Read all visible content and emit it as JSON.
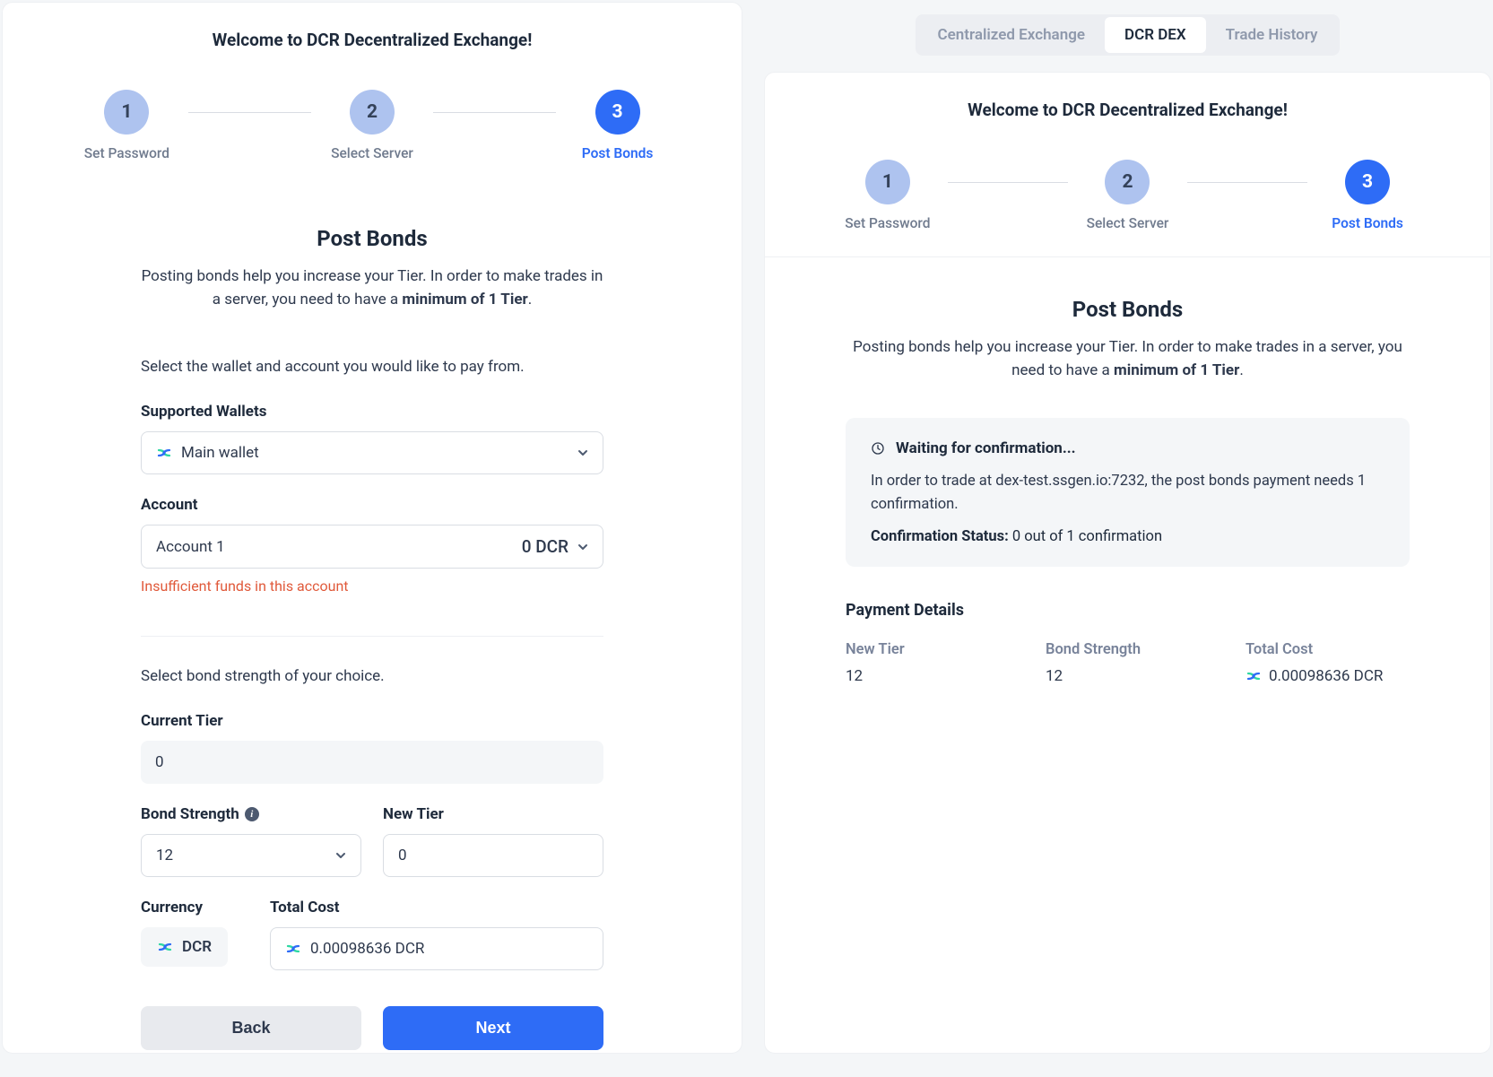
{
  "left": {
    "welcome": "Welcome to DCR Decentralized Exchange!",
    "steps": [
      {
        "num": "1",
        "label": "Set Password"
      },
      {
        "num": "2",
        "label": "Select Server"
      },
      {
        "num": "3",
        "label": "Post Bonds"
      }
    ],
    "title": "Post Bonds",
    "sub_a": "Posting bonds help you increase your Tier. In order to make trades in a server, you need to have a ",
    "sub_bold": "minimum of 1 Tier",
    "sub_c": ".",
    "select_wallet_line": "Select the wallet and account you would like to pay from.",
    "supported_wallets_label": "Supported Wallets",
    "wallet_value": "Main wallet",
    "account_label": "Account",
    "account_value": "Account 1",
    "account_balance": "0 DCR",
    "account_error": "Insufficient funds in this account",
    "bond_strength_line": "Select bond strength of your choice.",
    "current_tier_label": "Current Tier",
    "current_tier_value": "0",
    "bond_strength_label": "Bond Strength",
    "bond_strength_value": "12",
    "new_tier_label": "New Tier",
    "new_tier_value": "0",
    "currency_label": "Currency",
    "currency_value": "DCR",
    "total_cost_label": "Total Cost",
    "total_cost_value": "0.00098636 DCR",
    "back_btn": "Back",
    "next_btn": "Next"
  },
  "tabs": [
    {
      "label": "Centralized Exchange",
      "active": false
    },
    {
      "label": "DCR DEX",
      "active": true
    },
    {
      "label": "Trade History",
      "active": false
    }
  ],
  "right": {
    "welcome": "Welcome to DCR Decentralized Exchange!",
    "steps": [
      {
        "num": "1",
        "label": "Set Password"
      },
      {
        "num": "2",
        "label": "Select Server"
      },
      {
        "num": "3",
        "label": "Post Bonds"
      }
    ],
    "title": "Post Bonds",
    "sub_a": "Posting bonds help you increase your Tier. In order to make trades in a server, you need to have a ",
    "sub_bold": "minimum of 1 Tier",
    "sub_c": ".",
    "confirm_head": "Waiting for confirmation...",
    "confirm_text": "In order to trade at dex-test.ssgen.io:7232, the post bonds payment needs 1 confirmation.",
    "confirm_status_label": "Confirmation Status: ",
    "confirm_status_value": "0 out of 1 confirmation",
    "details_title": "Payment Details",
    "detail_tier_label": "New Tier",
    "detail_tier_value": "12",
    "detail_strength_label": "Bond Strength",
    "detail_strength_value": "12",
    "detail_cost_label": "Total Cost",
    "detail_cost_value": "0.00098636 DCR"
  }
}
